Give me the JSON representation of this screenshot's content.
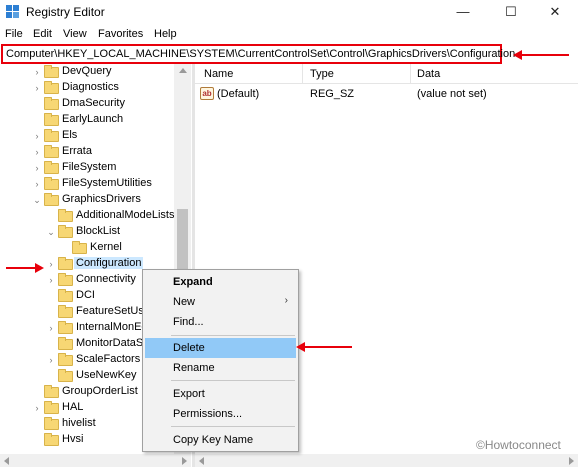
{
  "window": {
    "title": "Registry Editor",
    "minimize_glyph": "—",
    "maximize_glyph": "☐",
    "close_glyph": "✕"
  },
  "menu": [
    "File",
    "Edit",
    "View",
    "Favorites",
    "Help"
  ],
  "address": {
    "path": "Computer\\HKEY_LOCAL_MACHINE\\SYSTEM\\CurrentControlSet\\Control\\GraphicsDrivers\\Configuration"
  },
  "tree": {
    "nodes": [
      {
        "label": "DevQuery",
        "chevron": "›"
      },
      {
        "label": "Diagnostics",
        "chevron": "›"
      },
      {
        "label": "DmaSecurity",
        "chevron": ""
      },
      {
        "label": "EarlyLaunch",
        "chevron": ""
      },
      {
        "label": "Els",
        "chevron": "›"
      },
      {
        "label": "Errata",
        "chevron": "›"
      },
      {
        "label": "FileSystem",
        "chevron": "›"
      },
      {
        "label": "FileSystemUtilities",
        "chevron": "›"
      },
      {
        "label": "GraphicsDrivers",
        "chevron": "⌄"
      },
      {
        "label": "AdditionalModeLists",
        "chevron": ""
      },
      {
        "label": "BlockList",
        "chevron": "⌄"
      },
      {
        "label": "Kernel",
        "chevron": ""
      },
      {
        "label": "Configuration",
        "chevron": "›"
      },
      {
        "label": "Connectivity",
        "chevron": "›"
      },
      {
        "label": "DCI",
        "chevron": ""
      },
      {
        "label": "FeatureSetUsa",
        "chevron": ""
      },
      {
        "label": "InternalMonEc",
        "chevron": "›"
      },
      {
        "label": "MonitorDataS",
        "chevron": ""
      },
      {
        "label": "ScaleFactors",
        "chevron": "›"
      },
      {
        "label": "UseNewKey",
        "chevron": ""
      },
      {
        "label": "GroupOrderList",
        "chevron": ""
      },
      {
        "label": "HAL",
        "chevron": "›"
      },
      {
        "label": "hivelist",
        "chevron": ""
      },
      {
        "label": "Hvsi",
        "chevron": ""
      }
    ]
  },
  "list": {
    "columns": [
      "Name",
      "Type",
      "Data"
    ],
    "rows": [
      {
        "icon": "ab",
        "name": "(Default)",
        "type": "REG_SZ",
        "data": "(value not set)"
      }
    ]
  },
  "context_menu": {
    "items": [
      {
        "label": "Expand"
      },
      {
        "label": "New",
        "submenu": "›"
      },
      {
        "label": "Find..."
      },
      {
        "label": "Delete"
      },
      {
        "label": "Rename"
      },
      {
        "label": "Export"
      },
      {
        "label": "Permissions..."
      },
      {
        "label": "Copy Key Name"
      }
    ]
  },
  "watermark": "©Howtoconnect",
  "colors": {
    "annotation_red": "#e8000b",
    "highlight_blue": "#91c9f7",
    "selection_blue": "#cce8ff",
    "folder_yellow": "#f7d774"
  }
}
